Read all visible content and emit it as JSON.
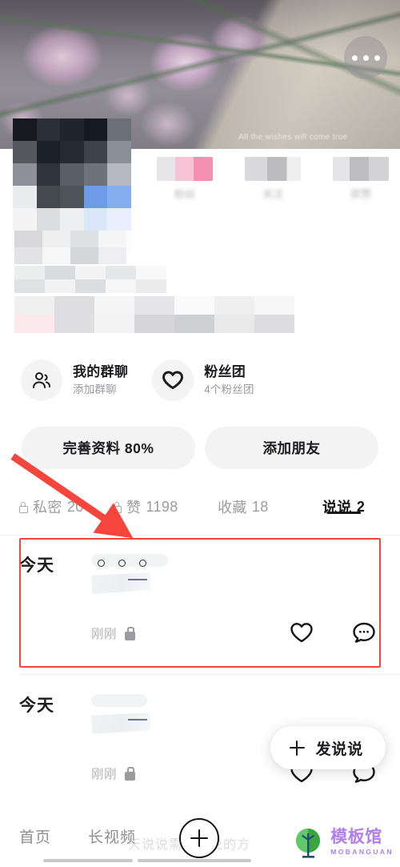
{
  "cover": {
    "caption": "All the wishes will come true",
    "more_icon": "more-horizontal-icon"
  },
  "stats": [
    {
      "label": "粉丝",
      "value": ""
    },
    {
      "label": "关注",
      "value": ""
    },
    {
      "label": "获赞",
      "value": ""
    }
  ],
  "entries": [
    {
      "icon": "group-people-icon",
      "title": "我的群聊",
      "subtitle": "添加群聊"
    },
    {
      "icon": "heart-outline-icon",
      "title": "粉丝团",
      "subtitle": "4个粉丝团"
    }
  ],
  "actions": {
    "complete_profile": "完善资料 80%",
    "add_friend": "添加朋友"
  },
  "tabs": [
    {
      "label": "私密",
      "count": "20",
      "locked": true,
      "active": false
    },
    {
      "label": "赞",
      "count": "1198",
      "locked": true,
      "active": false
    },
    {
      "label": "收藏",
      "count": "18",
      "locked": false,
      "active": false
    },
    {
      "label": "说说",
      "count": "2",
      "locked": false,
      "active": true
    }
  ],
  "feed": [
    {
      "day": "今天",
      "time": "刚刚",
      "private": true,
      "dots": 3,
      "highlighted": true
    },
    {
      "day": "今天",
      "time": "刚刚",
      "private": true,
      "dots": 0,
      "highlighted": false
    }
  ],
  "post_icons": {
    "like": "heart-outline-icon",
    "comment": "comment-bubble-icon"
  },
  "fab": {
    "label": "发说说",
    "icon": "plus-icon"
  },
  "bottom_nav": {
    "items": [
      {
        "label": "首页"
      },
      {
        "label": "长视频"
      }
    ],
    "plus_icon": "plus-circle-icon",
    "ghost_text": "天说说需要说说的方"
  },
  "watermark": {
    "cn": "模板馆",
    "en": "MOBANGUAN",
    "logo": "tree-logo-icon"
  },
  "annotation": {
    "color": "#f5453c",
    "arrow": "red-arrow-pointing-to-feed",
    "box": "red-highlight-box-around-first-post"
  }
}
